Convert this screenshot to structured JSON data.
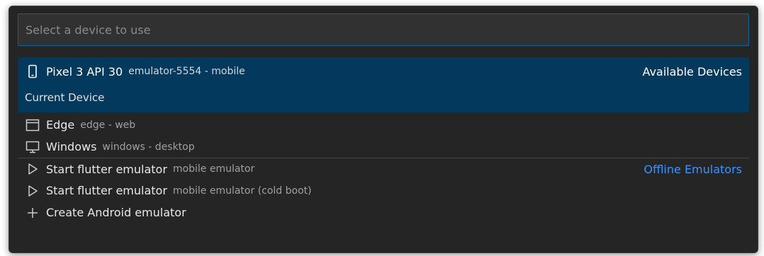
{
  "search": {
    "placeholder": "Select a device to use",
    "value": ""
  },
  "devices": {
    "group_label": "Available Devices",
    "items": [
      {
        "label": "Pixel 3 API 30",
        "description": "emulator-5554 - mobile",
        "detail": "Current Device",
        "icon": "mobile-phone-icon"
      },
      {
        "label": "Edge",
        "description": "edge - web",
        "icon": "browser-window-icon"
      },
      {
        "label": "Windows",
        "description": "windows - desktop",
        "icon": "desktop-monitor-icon"
      }
    ]
  },
  "emulators": {
    "group_label": "Offline Emulators",
    "items": [
      {
        "label": "Start flutter emulator",
        "description": "mobile emulator",
        "icon": "play-icon"
      },
      {
        "label": "Start flutter emulator",
        "description": "mobile emulator (cold boot)",
        "icon": "play-icon"
      },
      {
        "label": "Create Android emulator",
        "description": "",
        "icon": "plus-icon"
      }
    ]
  },
  "colors": {
    "selection": "#04395e",
    "focus_border": "#0e639c",
    "group_label_blue": "#3794ff",
    "background": "#252526"
  }
}
